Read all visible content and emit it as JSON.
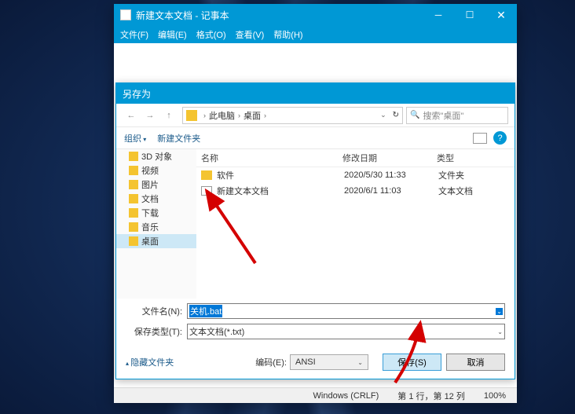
{
  "notepad": {
    "title": "新建文本文档 - 记事本",
    "menu": {
      "file": "文件(F)",
      "edit": "编辑(E)",
      "format": "格式(O)",
      "view": "查看(V)",
      "help": "帮助(H)"
    },
    "status": {
      "enc": "Windows (CRLF)",
      "pos": "第 1 行，第 12 列",
      "zoom": "100%"
    }
  },
  "dialog": {
    "title": "另存为",
    "path": {
      "root": "此电脑",
      "loc": "桌面"
    },
    "search_placeholder": "搜索\"桌面\"",
    "toolbar": {
      "organize": "组织",
      "newfolder": "新建文件夹"
    },
    "nav": [
      {
        "label": "3D 对象",
        "sel": false
      },
      {
        "label": "视频",
        "sel": false
      },
      {
        "label": "图片",
        "sel": false
      },
      {
        "label": "文档",
        "sel": false
      },
      {
        "label": "下载",
        "sel": false
      },
      {
        "label": "音乐",
        "sel": false
      },
      {
        "label": "桌面",
        "sel": true
      }
    ],
    "cols": {
      "name": "名称",
      "date": "修改日期",
      "type": "类型"
    },
    "rows": [
      {
        "name": "软件",
        "date": "2020/5/30 11:33",
        "type": "文件夹",
        "folder": true
      },
      {
        "name": "新建文本文档",
        "date": "2020/6/1 11:03",
        "type": "文本文档",
        "folder": false
      }
    ],
    "filename_lbl": "文件名(N):",
    "filename_val": "关机.bat",
    "filetype_lbl": "保存类型(T):",
    "filetype_val": "文本文档(*.txt)",
    "hide": "隐藏文件夹",
    "encoding_lbl": "编码(E):",
    "encoding_val": "ANSI",
    "save": "保存(S)",
    "cancel": "取消"
  }
}
